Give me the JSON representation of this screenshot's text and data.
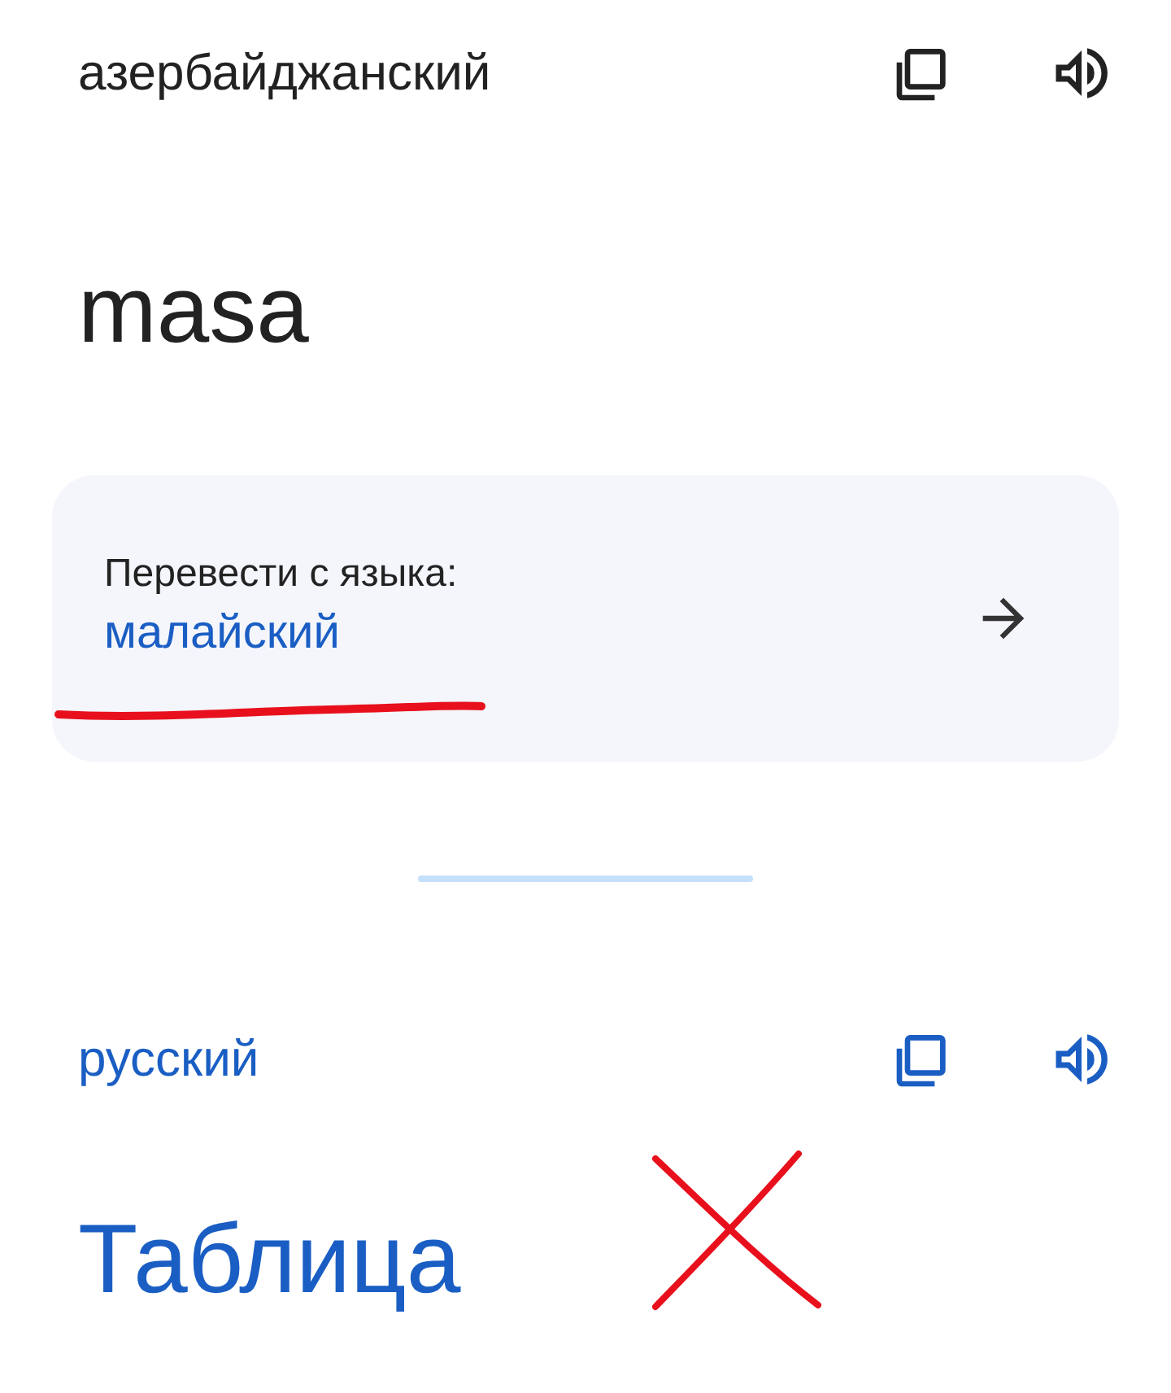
{
  "source": {
    "language": "азербайджанский",
    "text": "masa"
  },
  "detect_card": {
    "label": "Перевести с языка:",
    "language": "малайский"
  },
  "target": {
    "language": "русский",
    "text": "Таблица"
  }
}
